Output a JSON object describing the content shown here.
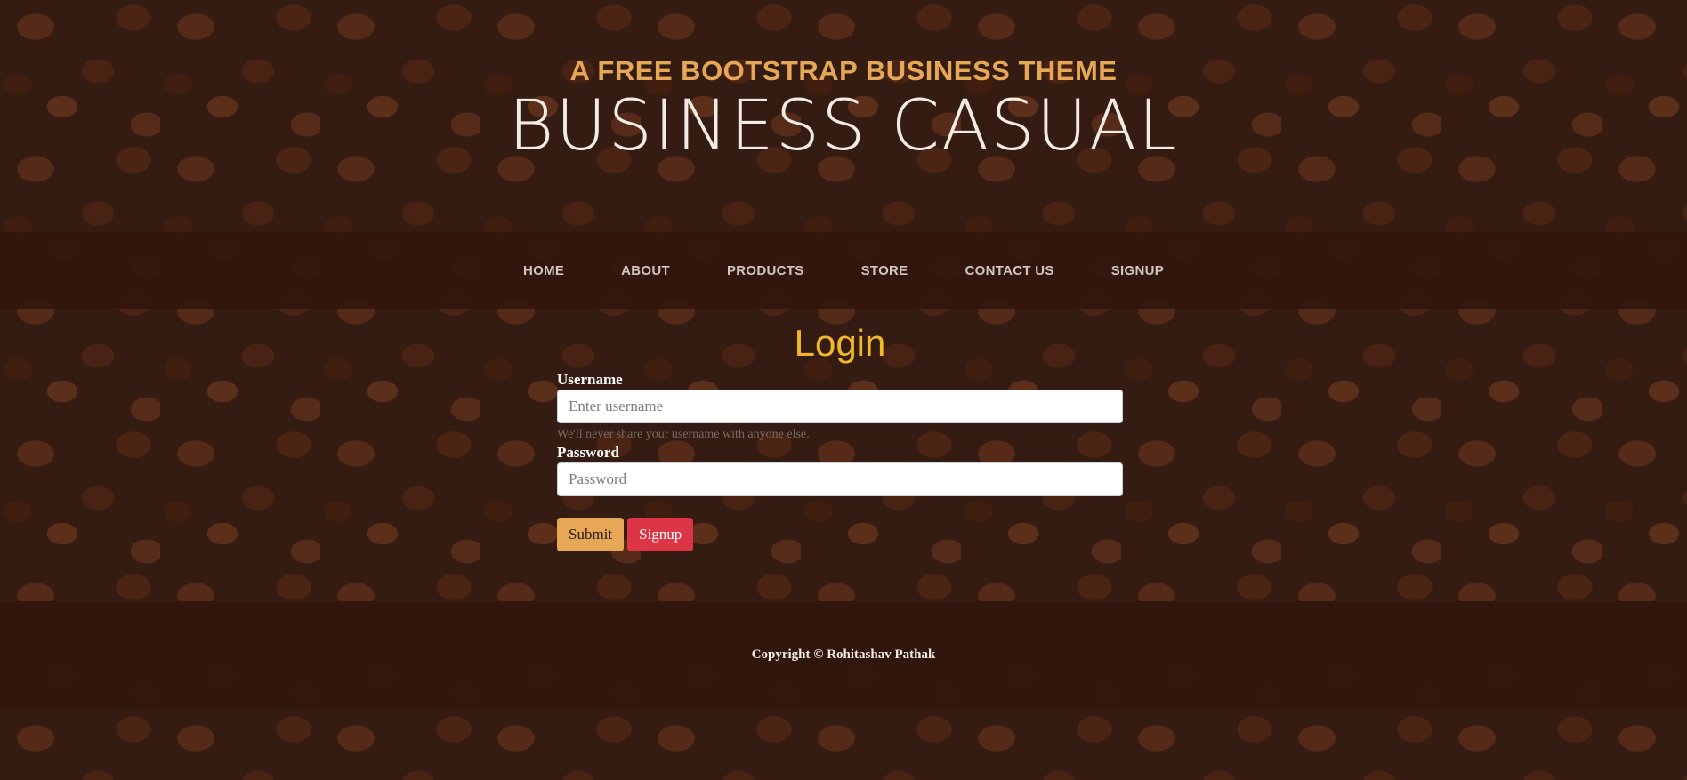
{
  "brand": {
    "upper": "A Free Bootstrap Business Theme",
    "lower": "Business Casual"
  },
  "nav": {
    "items": [
      {
        "label": "HOME"
      },
      {
        "label": "ABOUT"
      },
      {
        "label": "PRODUCTS"
      },
      {
        "label": "STORE"
      },
      {
        "label": "CONTACT US"
      },
      {
        "label": "SIGNUP"
      }
    ]
  },
  "login": {
    "title": "Login",
    "username_label": "Username",
    "username_placeholder": "Enter username",
    "username_help": "We'll never share your username with anyone else.",
    "password_label": "Password",
    "password_placeholder": "Password",
    "submit_label": "Submit",
    "signup_label": "Signup"
  },
  "footer": {
    "copyright": "Copyright © Rohitashav Pathak"
  },
  "colors": {
    "accent": "#e6a756",
    "title": "#f2b92a",
    "danger": "#dc3545",
    "nav_bg": "#32160e"
  }
}
